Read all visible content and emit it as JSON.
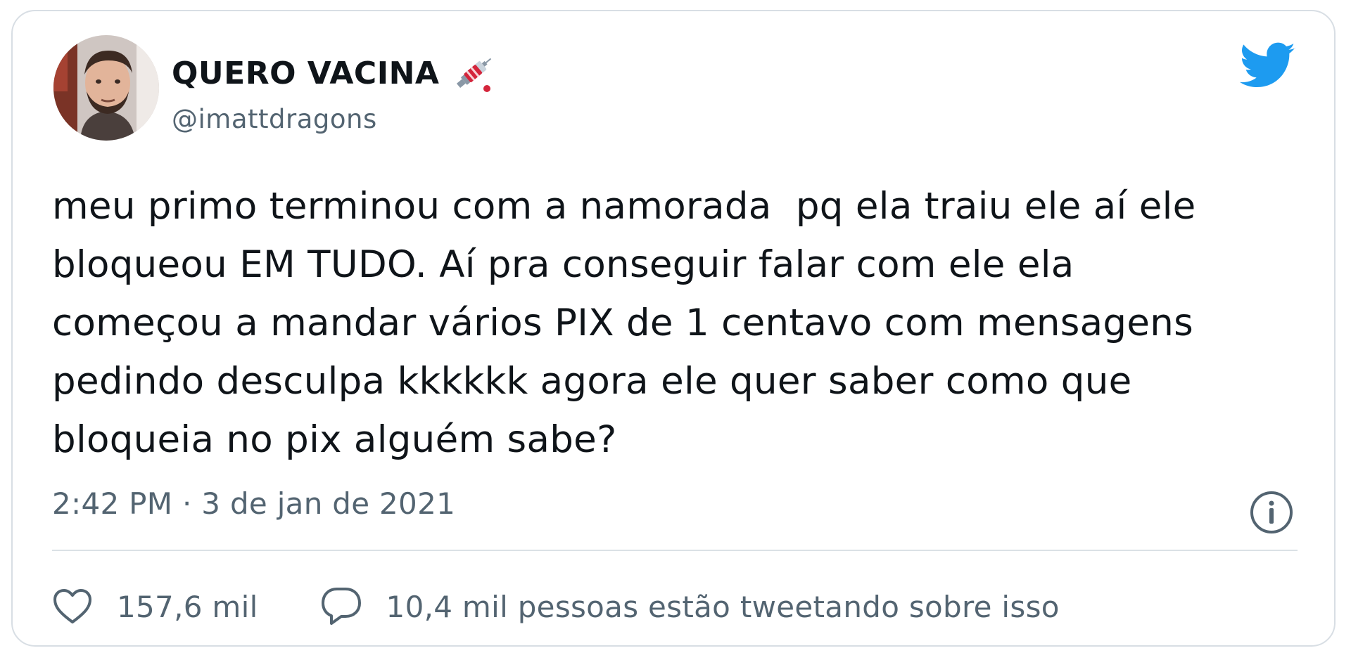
{
  "user": {
    "display_name": "QUERO VACINA",
    "display_name_emoji": "syringe-icon",
    "username": "@imattdragons",
    "avatar": "avatar"
  },
  "tweet": {
    "text_lines": [
      "meu primo terminou com a namorada  pq ela traiu ele aí ele",
      "bloqueou EM TUDO. Aí pra conseguir falar com ele ela",
      "começou a mandar vários PIX de 1 centavo com mensagens",
      "pedindo desculpa kkkkkk agora ele quer saber como que",
      "bloqueia no pix alguém sabe?"
    ],
    "timestamp": "2:42 PM · 3 de jan de 2021"
  },
  "actions": {
    "likes": "157,6 mil",
    "conversation": "10,4 mil pessoas estão tweetando sobre isso"
  },
  "icons": {
    "brand": "twitter-bird-icon",
    "info": "info-icon",
    "like": "heart-icon",
    "reply": "speech-bubble-icon"
  },
  "colors": {
    "brand_blue": "#1d9bf0",
    "text_primary": "#0f1419",
    "text_secondary": "#536471",
    "border": "#d8dee4",
    "syringe_red": "#d4253b"
  }
}
